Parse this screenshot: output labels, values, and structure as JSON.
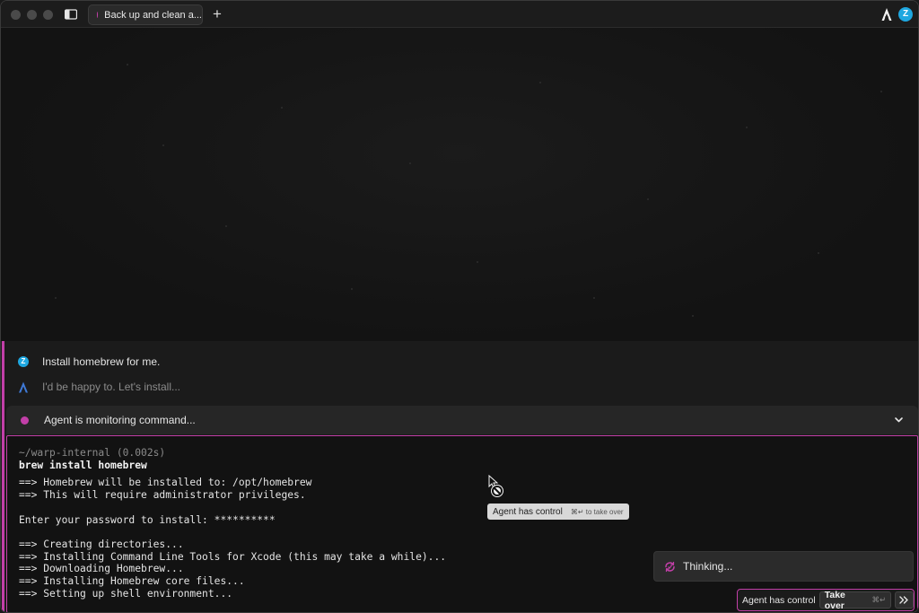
{
  "window": {
    "tab": {
      "title": "Back up and clean a...",
      "dot_color": "#c23fa8"
    },
    "new_tab": "+",
    "user_initial": "Z"
  },
  "conversation": {
    "user_message": "Install homebrew for me.",
    "agent_message": "I'd be happy to. Let's install...",
    "user_avatar_initial": "Z"
  },
  "monitor": {
    "label": "Agent is monitoring command..."
  },
  "terminal": {
    "prompt": "~/warp-internal (0.002s)",
    "command": "brew install homebrew",
    "output": [
      "==> Homebrew will be installed to: /opt/homebrew",
      "==> This will require administrator privileges.",
      "",
      "Enter your password to install: **********",
      "",
      "==> Creating directories...",
      "==> Installing Command Line Tools for Xcode (this may take a while)...",
      "==> Downloading Homebrew...",
      "==> Installing Homebrew core files...",
      "==> Setting up shell environment..."
    ]
  },
  "tooltip": {
    "label": "Agent has control",
    "hint": "⌘↵ to take over"
  },
  "thinking": {
    "label": "Thinking..."
  },
  "control_bar": {
    "label": "Agent has control",
    "take_over": "Take over",
    "take_over_key": "⌘↵"
  },
  "colors": {
    "accent": "#c23fa8",
    "user_avatar": "#1ea7e0"
  }
}
